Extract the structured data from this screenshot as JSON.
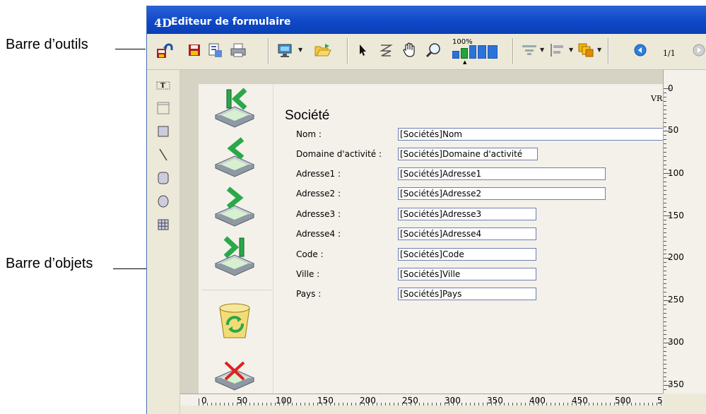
{
  "callouts": {
    "toolbar_label": "Barre d’outils",
    "objects_label": "Barre d’objets"
  },
  "window": {
    "logo": "4D",
    "title": "Editeur de formulaire"
  },
  "toolbar": {
    "zoom_label": "100%",
    "page_indicator": "1/1",
    "icons": [
      "undo-icon",
      "save-icon",
      "save-as-icon",
      "print-icon",
      "display-icon",
      "open-icon",
      "pointer-icon",
      "tab-order-icon",
      "hand-icon",
      "zoom-icon",
      "zoom-levels-icon",
      "align-icon",
      "distribute-icon",
      "layers-icon",
      "previous-page-icon",
      "next-page-icon"
    ]
  },
  "object_bar": {
    "icons": [
      "text-tool-icon",
      "group-box-icon",
      "rectangle-tool-icon",
      "line-tool-icon",
      "rounded-rect-tool-icon",
      "oval-tool-icon",
      "grid-tool-icon"
    ]
  },
  "form": {
    "title": "Société",
    "vr_marker": "VR",
    "fields": [
      {
        "label": "Nom :",
        "value": "[Sociétés]Nom"
      },
      {
        "label": "Domaine d'activité :",
        "value": "[Sociétés]Domaine d'activité"
      },
      {
        "label": "Adresse1 :",
        "value": "[Sociétés]Adresse1"
      },
      {
        "label": "Adresse2 :",
        "value": "[Sociétés]Adresse2"
      },
      {
        "label": "Adresse3 :",
        "value": "[Sociétés]Adresse3"
      },
      {
        "label": "Adresse4 :",
        "value": "[Sociétés]Adresse4"
      },
      {
        "label": "Code :",
        "value": "[Sociétés]Code"
      },
      {
        "label": "Ville :",
        "value": "[Sociétés]Ville"
      },
      {
        "label": "Pays :",
        "value": "[Sociétés]Pays"
      }
    ],
    "nav_buttons": [
      "first-record-icon",
      "previous-record-icon",
      "next-record-icon",
      "last-record-icon",
      "delete-record-icon",
      "cancel-icon"
    ]
  },
  "rulers": {
    "vertical": [
      "0",
      "50",
      "100",
      "150",
      "200",
      "250",
      "300",
      "350"
    ],
    "horizontal": [
      "0",
      "50",
      "100",
      "150",
      "200",
      "250",
      "300",
      "350",
      "400",
      "450",
      "500",
      "5"
    ]
  }
}
